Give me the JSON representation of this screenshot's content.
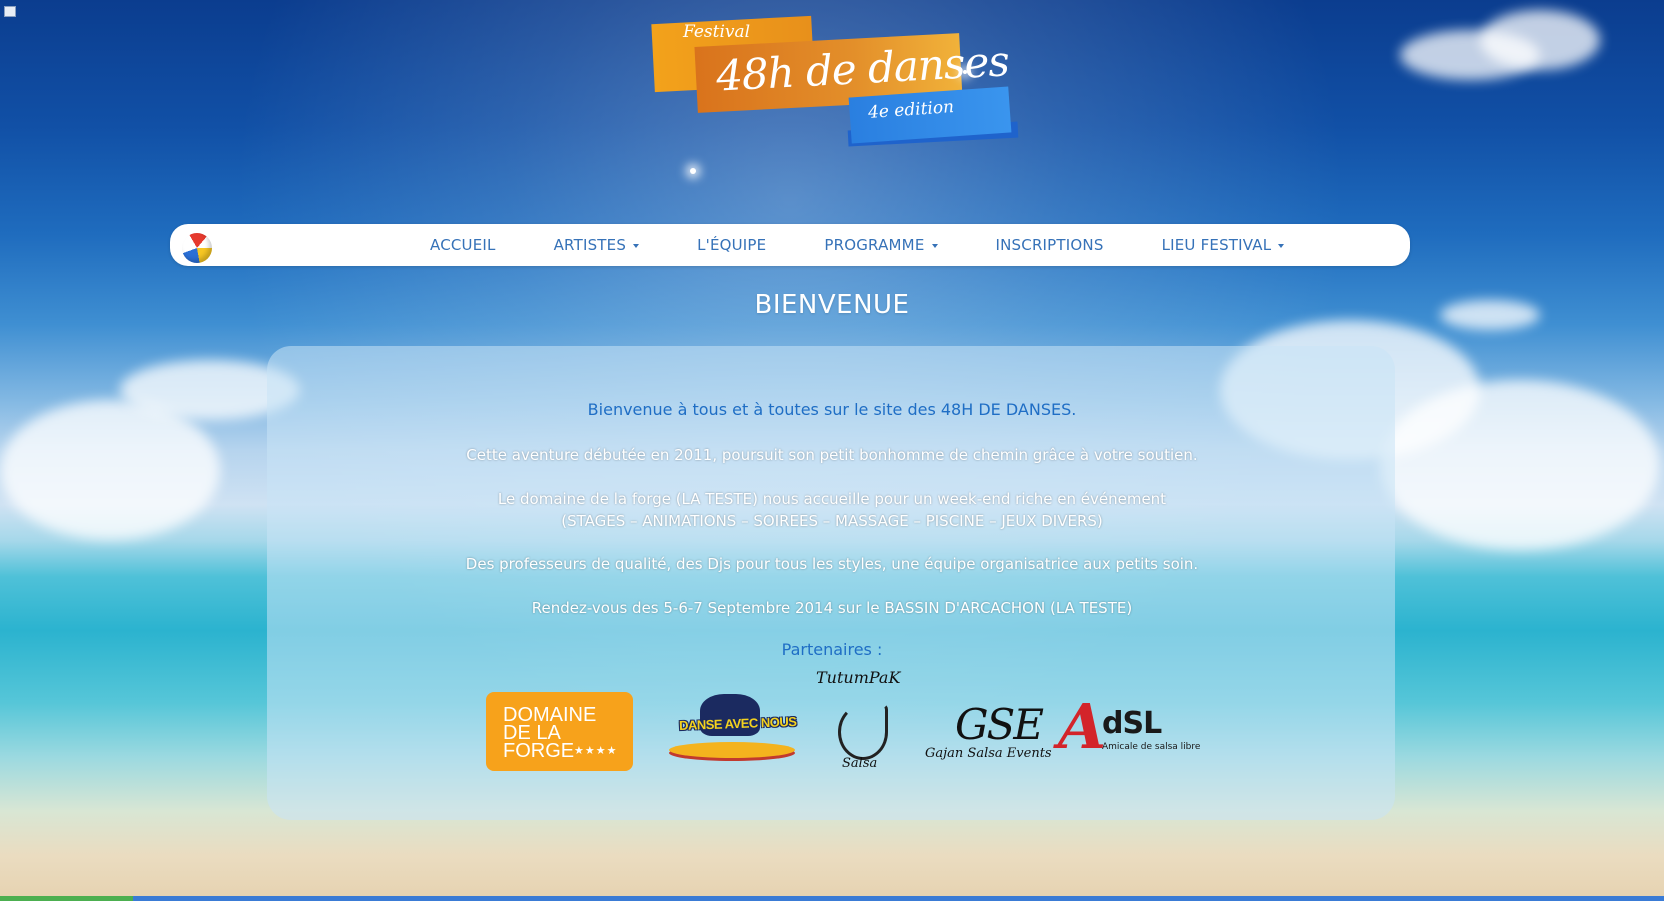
{
  "logo": {
    "festival": "Festival",
    "title": "48h de danses",
    "edition": "4e edition"
  },
  "nav": {
    "items": [
      {
        "label": "ACCUEIL",
        "dropdown": false
      },
      {
        "label": "ARTISTES",
        "dropdown": true
      },
      {
        "label": "L'ÉQUIPE",
        "dropdown": false
      },
      {
        "label": "PROGRAMME",
        "dropdown": true
      },
      {
        "label": "INSCRIPTIONS",
        "dropdown": false
      },
      {
        "label": "LIEU FESTIVAL",
        "dropdown": true
      }
    ]
  },
  "page": {
    "title": "BIENVENUE"
  },
  "content": {
    "welcome": "Bienvenue à tous et à toutes sur le site des 48H DE DANSES.",
    "para1": "Cette aventure débutée en 2011, poursuit son petit bonhomme de chemin grâce à votre soutien.",
    "para2_line1": "Le domaine de la forge (LA TESTE) nous accueille pour un week-end riche en événement",
    "para2_line2": "(STAGES – ANIMATIONS – SOIREES – MASSAGE – PISCINE – JEUX DIVERS)",
    "para3": "Des professeurs de qualité, des Djs pour tous les styles, une équipe organisatrice aux petits soin.",
    "para4": "Rendez-vous des 5-6-7 Septembre 2014 sur le BASSIN D'ARCACHON (LA TESTE)",
    "partners_label": "Partenaires :"
  },
  "partners": {
    "forge": {
      "line1": "DOMAINE",
      "line2": "DE LA",
      "line3": "FORGE",
      "stars": "★★★★"
    },
    "danse": {
      "text": "DANSE AVEC NOUS"
    },
    "tutumpak": {
      "name": "TutumPaK",
      "sub": "Salsa"
    },
    "gse": {
      "big": "GSE",
      "small": "Gajan Salsa Events"
    },
    "adsl": {
      "a": "A",
      "rest": "dSL",
      "sub": "Amicale de salsa libre"
    }
  },
  "colors": {
    "nav_text": "#3672b8",
    "accent_blue": "#1f6ec5",
    "forge_orange": "#f7a21b",
    "adsl_red": "#d3242a"
  },
  "icons": {
    "corner": "page-icon",
    "ball": "beach-ball-icon"
  }
}
